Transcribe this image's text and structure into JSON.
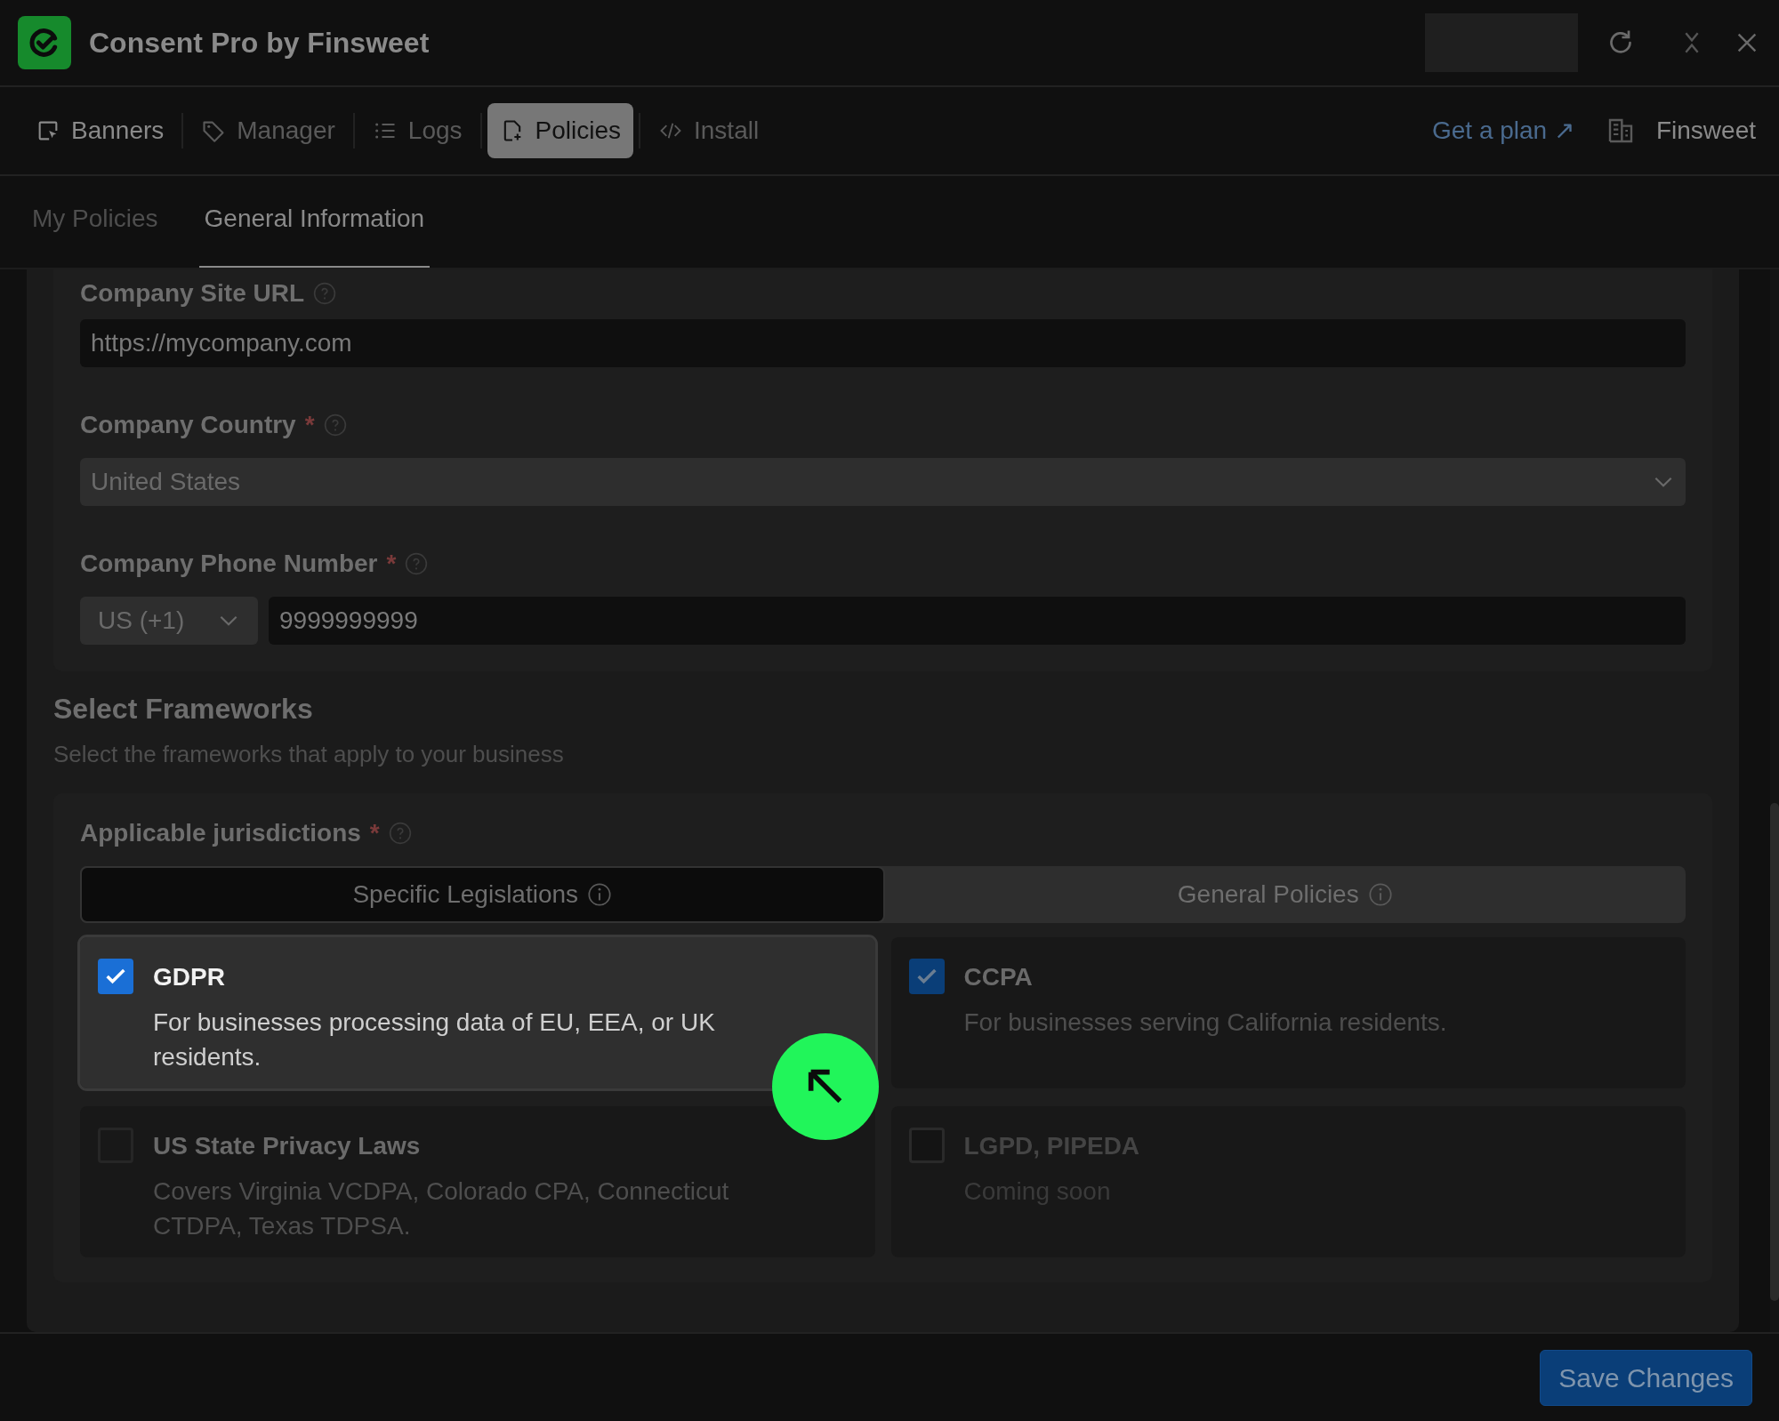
{
  "window": {
    "title": "Consent Pro by Finsweet"
  },
  "nav": {
    "items": [
      {
        "label": "Banners",
        "kind": "banner",
        "selected": false
      },
      {
        "label": "Manager",
        "kind": "tag",
        "selected": false
      },
      {
        "label": "Logs",
        "kind": "list",
        "selected": false
      },
      {
        "label": "Policies",
        "kind": "file",
        "selected": true
      },
      {
        "label": "Install",
        "kind": "code",
        "selected": false
      }
    ],
    "plan_link": "Get a plan ↗",
    "workspace": "Finsweet"
  },
  "subtabs": [
    {
      "label": "My Policies",
      "selected": false
    },
    {
      "label": "General Information",
      "selected": true
    }
  ],
  "company": {
    "url_label": "Company Site URL",
    "url_value": "https://mycompany.com",
    "country_label": "Company Country",
    "country_required": "*",
    "country_value": "United States",
    "phone_label": "Company Phone Number",
    "phone_required": "*",
    "phone_code": "US (+1)",
    "phone_value": "9999999999"
  },
  "frameworks": {
    "title": "Select Frameworks",
    "subtitle": "Select the frameworks that apply to your business",
    "jurisdictions_label": "Applicable jurisdictions",
    "jurisdictions_required": "*",
    "segments": [
      {
        "label": "Specific Legislations",
        "selected": true
      },
      {
        "label": "General Policies",
        "selected": false
      }
    ],
    "items": [
      {
        "name": "GDPR",
        "description": "For businesses processing data of EU, EEA, or UK residents.",
        "checked": true,
        "disabled": false,
        "highlighted": true
      },
      {
        "name": "CCPA",
        "description": "For businesses serving California residents.",
        "checked": true,
        "disabled": false,
        "highlighted": false
      },
      {
        "name": "US State Privacy Laws",
        "description": "Covers Virginia VCDPA, Colorado CPA, Connecticut CTDPA, Texas TDPSA.",
        "checked": false,
        "disabled": false,
        "highlighted": false
      },
      {
        "name": "LGPD, PIPEDA",
        "description": "Coming soon",
        "checked": false,
        "disabled": true,
        "highlighted": false
      }
    ]
  },
  "footer": {
    "save_button": "Save Changes"
  }
}
